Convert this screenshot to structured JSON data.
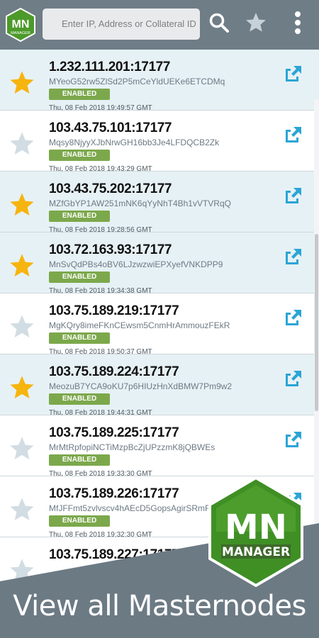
{
  "app": {
    "logo_top": "MN",
    "logo_bottom": "MANAGER"
  },
  "search": {
    "placeholder": "Enter IP, Address or Collateral ID"
  },
  "toolbar": {
    "icons": [
      "search-icon",
      "star-icon",
      "more-vert-icon"
    ]
  },
  "colors": {
    "accent_green": "#7ca84c",
    "star_on": "#f6b40f",
    "star_off": "#d2dde3",
    "ext_link": "#2aa5d6",
    "header": "#6f7d87"
  },
  "masternodes": [
    {
      "address": "1.232.111.201:17177",
      "collateral": "MYeoG52rw5ZlSd2P5mCeYldUEKe6ETCDMq",
      "status": "ENABLED",
      "date": "Thu, 08 Feb 2018 19:49:57 GMT",
      "favorite": true
    },
    {
      "address": "103.43.75.101:17177",
      "collateral": "Mqsy8NjyyXJbNrwGH16bb3Je4LFDQCB2Zk",
      "status": "ENABLED",
      "date": "Thu, 08 Feb 2018 19:43:29 GMT",
      "favorite": false
    },
    {
      "address": "103.43.75.202:17177",
      "collateral": "MZfGbYP1AW251mNK6qYyNhT4Bh1vVTVRqQ",
      "status": "ENABLED",
      "date": "Thu, 08 Feb 2018 19:28:56 GMT",
      "favorite": true
    },
    {
      "address": "103.72.163.93:17177",
      "collateral": "MnSvQdPBs4oBV6LJzwzwiEPXyefVNKDPP9",
      "status": "ENABLED",
      "date": "Thu, 08 Feb 2018 19:34:38 GMT",
      "favorite": true
    },
    {
      "address": "103.75.189.219:17177",
      "collateral": "MgKQry8imeFKnCEwsm5CnmHrAmmouzFEkR",
      "status": "ENABLED",
      "date": "Thu, 08 Feb 2018 19:50:37 GMT",
      "favorite": false
    },
    {
      "address": "103.75.189.224:17177",
      "collateral": "MeozuB7YCA9oKU7p6HIUzHnXdBMW7Pm9w2",
      "status": "ENABLED",
      "date": "Thu, 08 Feb 2018 19:44:31 GMT",
      "favorite": true
    },
    {
      "address": "103.75.189.225:17177",
      "collateral": "MrMtRpfopiNCTiMzpBcZjUPzzmK8jQBWEs",
      "status": "ENABLED",
      "date": "Thu, 08 Feb 2018 19:33:30 GMT",
      "favorite": false
    },
    {
      "address": "103.75.189.226:17177",
      "collateral": "MfJFFmt5zvlvscv4hAEcD5GopsAgirSRmF",
      "status": "ENABLED",
      "date": "Thu, 08 Feb 2018 19:32:30 GMT",
      "favorite": false
    },
    {
      "address": "103.75.189.227:17177",
      "collateral": "",
      "status": "",
      "date": "",
      "favorite": false
    }
  ],
  "promo": {
    "caption": "View all Masternodes",
    "logo_top": "MN",
    "logo_bottom": "MANAGER"
  }
}
